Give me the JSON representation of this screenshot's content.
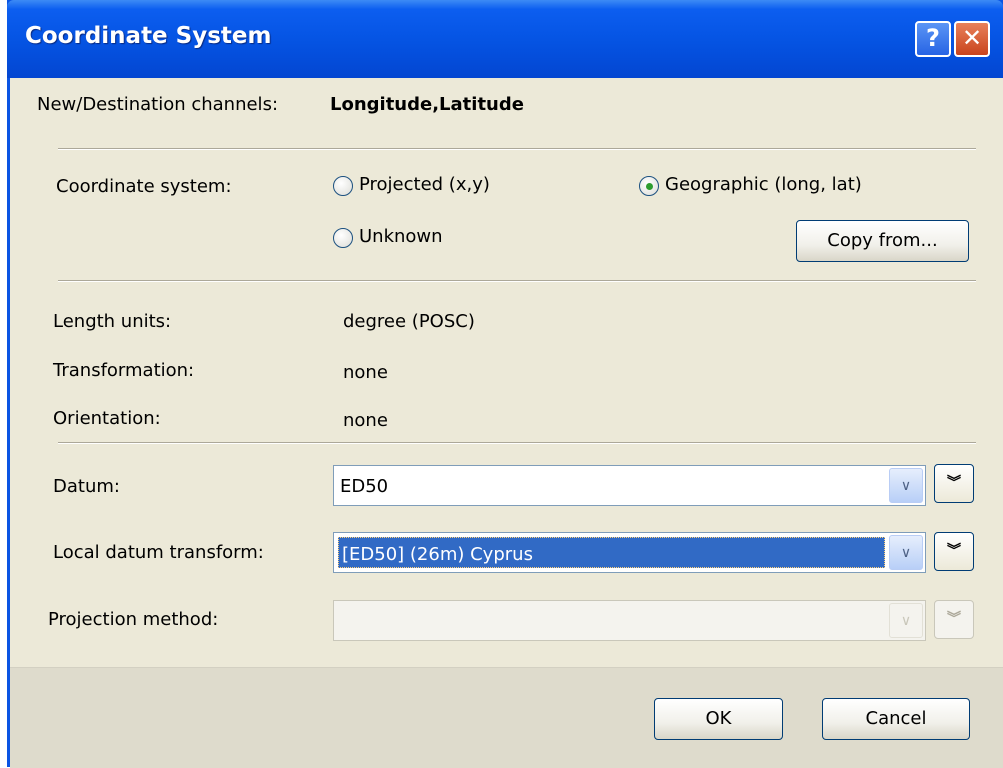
{
  "window": {
    "title": "Coordinate System",
    "help_glyph": "?",
    "close_glyph": "✕"
  },
  "channels": {
    "label": "New/Destination channels:",
    "value": "Longitude,Latitude"
  },
  "coordinate_system": {
    "label": "Coordinate system:",
    "options": [
      {
        "label": "Projected (x,y)",
        "selected": false
      },
      {
        "label": "Geographic (long, lat)",
        "selected": true
      },
      {
        "label": "Unknown",
        "selected": false
      }
    ],
    "copy_button": "Copy from..."
  },
  "properties": [
    {
      "label": "Length units:",
      "value": "degree (POSC)"
    },
    {
      "label": "Transformation:",
      "value": "none"
    },
    {
      "label": "Orientation:",
      "value": "none"
    }
  ],
  "datum": {
    "label": "Datum:",
    "value": "ED50"
  },
  "local_datum_transform": {
    "label": "Local datum transform:",
    "value": "[ED50] (26m) Cyprus"
  },
  "projection_method": {
    "label": "Projection method:",
    "value": ""
  },
  "icons": {
    "dropdown": "chevron-down-icon",
    "expand": "double-chevron-down-icon",
    "arrow_glyph": "∨",
    "expand_glyph": "︾"
  },
  "footer": {
    "ok": "OK",
    "cancel": "Cancel"
  }
}
